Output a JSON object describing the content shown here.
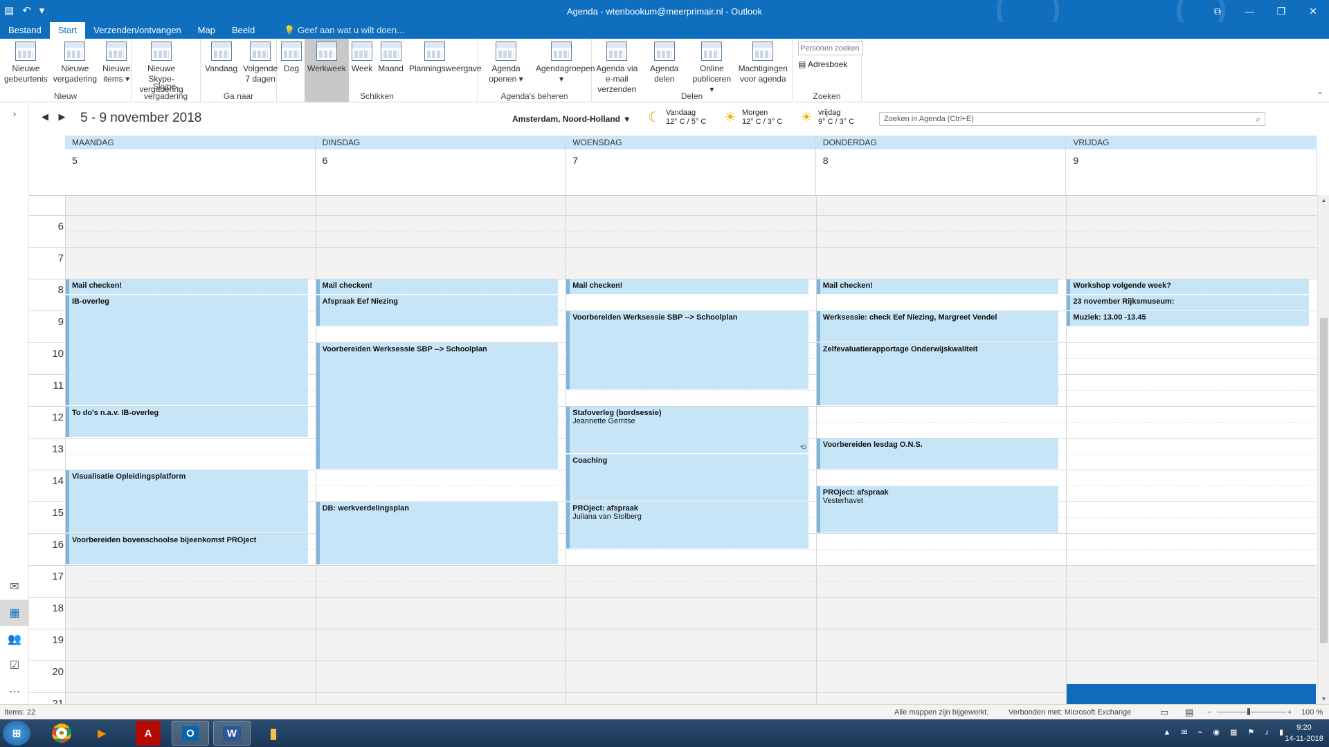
{
  "titlebar": {
    "title": "Agenda - wtenbookum@meerprimair.nl - Outlook",
    "qat": [
      "▤",
      "↶",
      "▾"
    ],
    "win_controls": [
      "⧉",
      "—",
      "❐",
      "✕"
    ]
  },
  "tabs": [
    "Bestand",
    "Start",
    "Verzenden/ontvangen",
    "Map",
    "Beeld"
  ],
  "tell_me": "Geef aan wat u wilt doen...",
  "ribbon": {
    "groups": [
      {
        "label": "Nieuw",
        "buttons": [
          "Nieuwe gebeurtenis",
          "Nieuwe vergadering",
          "Nieuwe items ▾"
        ]
      },
      {
        "label": "Skype-vergadering",
        "buttons": [
          "Nieuwe Skype-vergadering"
        ]
      },
      {
        "label": "Ga naar",
        "buttons": [
          "Vandaag",
          "Volgende 7 dagen"
        ]
      },
      {
        "label": "Schikken",
        "buttons": [
          "Dag",
          "Werkweek",
          "Week",
          "Maand",
          "Planningsweergave"
        ]
      },
      {
        "label": "Agenda's beheren",
        "buttons": [
          "Agenda openen ▾",
          "Agendagroepen ▾"
        ]
      },
      {
        "label": "Delen",
        "buttons": [
          "Agenda via e-mail verzenden",
          "Agenda delen",
          "Online publiceren ▾",
          "Machtigingen voor agenda"
        ]
      },
      {
        "label": "Zoeken",
        "search_placeholder": "Personen zoeken",
        "adresboek": "Adresboek"
      }
    ],
    "selected_button": "Werkweek"
  },
  "header": {
    "range": "5 - 9 november 2018",
    "location": "Amsterdam, Noord-Holland",
    "weather": [
      {
        "day": "Vandaag",
        "temp": "12° C / 5° C",
        "icon": "moon-icon"
      },
      {
        "day": "Morgen",
        "temp": "12° C / 3° C",
        "icon": "sun-icon"
      },
      {
        "day": "vrijdag",
        "temp": "9° C / 3° C",
        "icon": "sun-icon"
      }
    ],
    "search_placeholder": "Zoeken in Agenda (Ctrl+E)"
  },
  "days": [
    {
      "name": "MAANDAG",
      "num": "5"
    },
    {
      "name": "DINSDAG",
      "num": "6"
    },
    {
      "name": "WOENSDAG",
      "num": "7"
    },
    {
      "name": "DONDERDAG",
      "num": "8"
    },
    {
      "name": "VRIJDAG",
      "num": "9"
    }
  ],
  "hours": [
    "6",
    "7",
    "8",
    "9",
    "10",
    "11",
    "12",
    "13",
    "14",
    "15",
    "16",
    "17",
    "18",
    "19",
    "20",
    "21"
  ],
  "events": [
    {
      "day": 0,
      "start": 8.0,
      "end": 8.5,
      "title": "Mail checken!"
    },
    {
      "day": 0,
      "start": 8.5,
      "end": 12.0,
      "title": "IB-overleg"
    },
    {
      "day": 0,
      "start": 12.0,
      "end": 13.0,
      "title": "To do's n.a.v. IB-overleg"
    },
    {
      "day": 0,
      "start": 14.0,
      "end": 16.0,
      "title": "Visualisatie Opleidingsplatform"
    },
    {
      "day": 0,
      "start": 16.0,
      "end": 17.0,
      "title": "Voorbereiden bovenschoolse bijeenkomst PROject"
    },
    {
      "day": 1,
      "start": 8.0,
      "end": 8.5,
      "title": "Mail checken!"
    },
    {
      "day": 1,
      "start": 8.5,
      "end": 9.5,
      "title": "Afspraak Eef Niezing"
    },
    {
      "day": 1,
      "start": 10.0,
      "end": 14.0,
      "title": "Voorbereiden Werksessie SBP --> Schoolplan"
    },
    {
      "day": 1,
      "start": 15.0,
      "end": 17.0,
      "title": "DB: werkverdelingsplan"
    },
    {
      "day": 2,
      "start": 8.0,
      "end": 8.5,
      "title": "Mail checken!"
    },
    {
      "day": 2,
      "start": 9.0,
      "end": 11.5,
      "title": "Voorbereiden Werksessie SBP --> Schoolplan"
    },
    {
      "day": 2,
      "start": 12.0,
      "end": 13.5,
      "title": "Stafoverleg (bordsessie)",
      "location": "Jeannette Gerritse",
      "recurring": true
    },
    {
      "day": 2,
      "start": 13.5,
      "end": 15.0,
      "title": "Coaching"
    },
    {
      "day": 2,
      "start": 15.0,
      "end": 16.5,
      "title": "PROject: afspraak",
      "location": "Juliana van Stolberg"
    },
    {
      "day": 3,
      "start": 8.0,
      "end": 8.5,
      "title": "Mail checken!"
    },
    {
      "day": 3,
      "start": 9.0,
      "end": 10.0,
      "title": "Werksessie: check Eef Niezing, Margreet Vendel"
    },
    {
      "day": 3,
      "start": 10.0,
      "end": 12.0,
      "title": "Zelfevaluatierapportage Onderwijskwaliteit"
    },
    {
      "day": 3,
      "start": 13.0,
      "end": 14.0,
      "title": "Voorbereiden lesdag O.N.S."
    },
    {
      "day": 3,
      "start": 14.5,
      "end": 16.0,
      "title": "PROject: afspraak",
      "location": "Vesterhavet"
    },
    {
      "day": 4,
      "start": 8.0,
      "end": 8.5,
      "title": "Workshop volgende week?"
    },
    {
      "day": 4,
      "start": 8.5,
      "end": 9.0,
      "title": "23 november Rijksmuseum:"
    },
    {
      "day": 4,
      "start": 9.0,
      "end": 9.5,
      "title": "Muziek: 13.00 -13.45"
    }
  ],
  "status": {
    "items": "Items: 22",
    "synced": "Alle mappen zijn bijgewerkt.",
    "connected": "Verbonden met: Microsoft Exchange",
    "zoom": "100 %"
  },
  "taskbar": {
    "clock_time": "9:20",
    "clock_date": "14-11-2018"
  },
  "colors": {
    "accent": "#106ebe",
    "event_bg": "#c6e6f8",
    "event_border": "#7fb5db"
  }
}
